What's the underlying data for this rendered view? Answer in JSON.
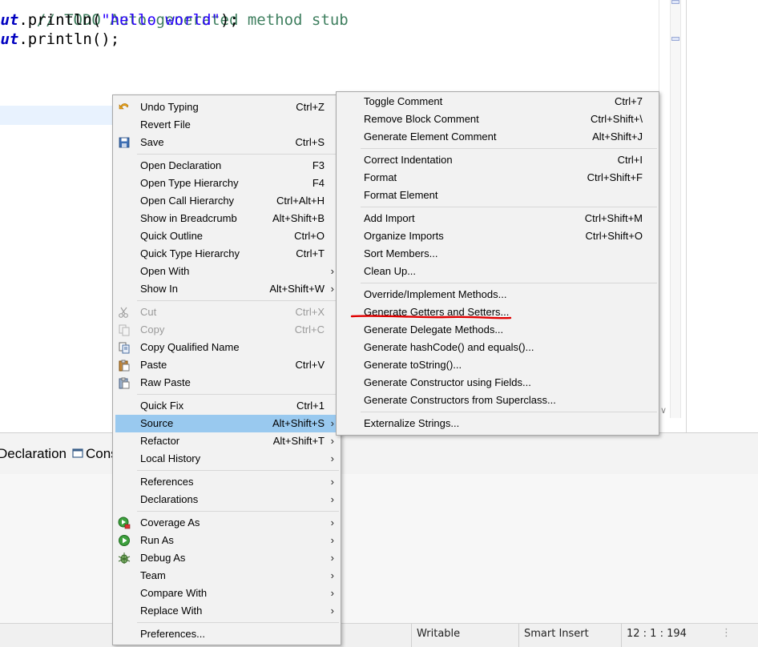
{
  "editor": {
    "lines": [
      {
        "comment": "// TODO Auto-generated method stub"
      },
      {
        "field": "out",
        "call": ".println(",
        "str": "\"hello world\"",
        "end": ");"
      },
      {
        "field": "out",
        "call": ".println();"
      }
    ]
  },
  "tabs": {
    "declaration": "Declaration",
    "console": "Cons"
  },
  "status_bar": {
    "writable": "Writable",
    "insert_mode": "Smart Insert",
    "position": "12 : 1 : 194"
  },
  "context_menu": {
    "items": [
      {
        "label": "Undo Typing",
        "shortcut": "Ctrl+Z",
        "icon": "undo-icon"
      },
      {
        "label": "Revert File",
        "shortcut": ""
      },
      {
        "label": "Save",
        "shortcut": "Ctrl+S",
        "icon": "save-icon"
      },
      {
        "label": "Open Declaration",
        "shortcut": "F3"
      },
      {
        "label": "Open Type Hierarchy",
        "shortcut": "F4"
      },
      {
        "label": "Open Call Hierarchy",
        "shortcut": "Ctrl+Alt+H"
      },
      {
        "label": "Show in Breadcrumb",
        "shortcut": "Alt+Shift+B"
      },
      {
        "label": "Quick Outline",
        "shortcut": "Ctrl+O"
      },
      {
        "label": "Quick Type Hierarchy",
        "shortcut": "Ctrl+T"
      },
      {
        "label": "Open With",
        "shortcut": ""
      },
      {
        "label": "Show In",
        "shortcut": "Alt+Shift+W"
      },
      {
        "label": "Cut",
        "shortcut": "Ctrl+X",
        "icon": "cut-icon"
      },
      {
        "label": "Copy",
        "shortcut": "Ctrl+C",
        "icon": "copy-icon"
      },
      {
        "label": "Copy Qualified Name",
        "shortcut": "",
        "icon": "copy-qualified-icon"
      },
      {
        "label": "Paste",
        "shortcut": "Ctrl+V",
        "icon": "paste-icon"
      },
      {
        "label": "Raw Paste",
        "shortcut": "",
        "icon": "raw-paste-icon"
      },
      {
        "label": "Quick Fix",
        "shortcut": "Ctrl+1"
      },
      {
        "label": "Source",
        "shortcut": "Alt+Shift+S"
      },
      {
        "label": "Refactor",
        "shortcut": "Alt+Shift+T"
      },
      {
        "label": "Local History",
        "shortcut": ""
      },
      {
        "label": "References",
        "shortcut": ""
      },
      {
        "label": "Declarations",
        "shortcut": ""
      },
      {
        "label": "Coverage As",
        "shortcut": "",
        "icon": "coverage-icon"
      },
      {
        "label": "Run As",
        "shortcut": "",
        "icon": "run-icon"
      },
      {
        "label": "Debug As",
        "shortcut": "",
        "icon": "debug-icon"
      },
      {
        "label": "Team",
        "shortcut": ""
      },
      {
        "label": "Compare With",
        "shortcut": ""
      },
      {
        "label": "Replace With",
        "shortcut": ""
      },
      {
        "label": "Preferences...",
        "shortcut": ""
      }
    ]
  },
  "source_submenu": {
    "items": [
      {
        "label": "Toggle Comment",
        "shortcut": "Ctrl+7"
      },
      {
        "label": "Remove Block Comment",
        "shortcut": "Ctrl+Shift+\\"
      },
      {
        "label": "Generate Element Comment",
        "shortcut": "Alt+Shift+J"
      },
      {
        "label": "Correct Indentation",
        "shortcut": "Ctrl+I"
      },
      {
        "label": "Format",
        "shortcut": "Ctrl+Shift+F"
      },
      {
        "label": "Format Element",
        "shortcut": ""
      },
      {
        "label": "Add Import",
        "shortcut": "Ctrl+Shift+M"
      },
      {
        "label": "Organize Imports",
        "shortcut": "Ctrl+Shift+O"
      },
      {
        "label": "Sort Members...",
        "shortcut": ""
      },
      {
        "label": "Clean Up...",
        "shortcut": ""
      },
      {
        "label": "Override/Implement Methods...",
        "shortcut": ""
      },
      {
        "label": "Generate Getters and Setters...",
        "shortcut": ""
      },
      {
        "label": "Generate Delegate Methods...",
        "shortcut": ""
      },
      {
        "label": "Generate hashCode() and equals()...",
        "shortcut": ""
      },
      {
        "label": "Generate toString()...",
        "shortcut": ""
      },
      {
        "label": "Generate Constructor using Fields...",
        "shortcut": ""
      },
      {
        "label": "Generate Constructors from Superclass...",
        "shortcut": ""
      },
      {
        "label": "Externalize Strings...",
        "shortcut": ""
      }
    ]
  },
  "colors": {
    "selection": "#99c9ef",
    "annotation": "#e00000"
  }
}
